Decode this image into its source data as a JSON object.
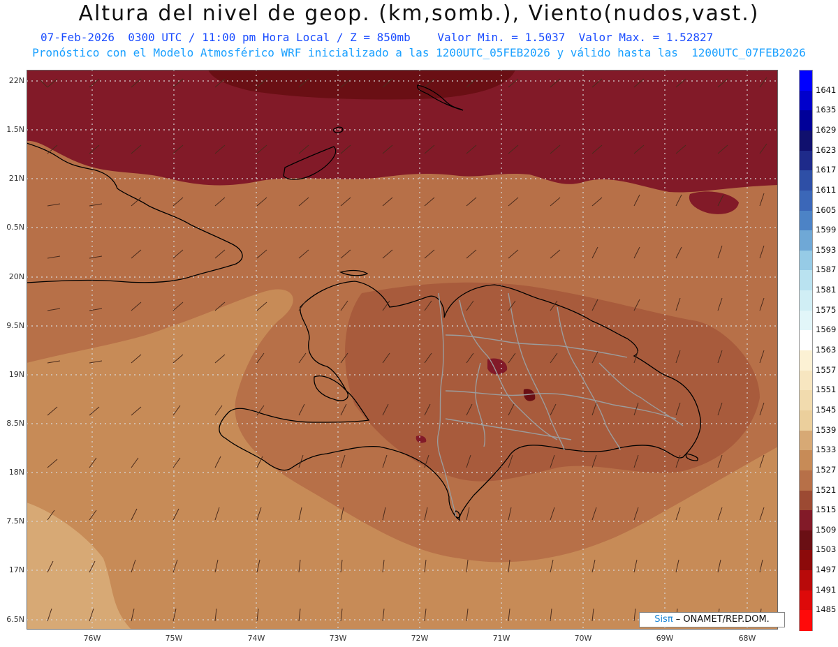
{
  "title": "Altura del nivel de geop. (km,somb.), Viento(nudos,vast.)",
  "subtitle_line1": "07-Feb-2026  0300 UTC / 11:00 pm Hora Local / Z = 850mb    Valor Min. = 1.5037  Valor Max. = 1.52827",
  "subtitle_line2": "Pronóstico con el Modelo Atmosférico WRF inicializado a las 1200UTC_05FEB2026 y válido hasta las  1200UTC_07FEB2026",
  "lat_labels": [
    "22N",
    "1.5N",
    "21N",
    "0.5N",
    "20N",
    "9.5N",
    "19N",
    "8.5N",
    "18N",
    "7.5N",
    "17N",
    "6.5N"
  ],
  "lon_labels": [
    "76W",
    "75W",
    "74W",
    "73W",
    "72W",
    "71W",
    "70W",
    "69W",
    "68W"
  ],
  "colorbar": {
    "labels": [
      "1641",
      "1635",
      "1629",
      "1623",
      "1617",
      "1611",
      "1605",
      "1599",
      "1593",
      "1587",
      "1581",
      "1575",
      "1569",
      "1563",
      "1557",
      "1551",
      "1545",
      "1539",
      "1533",
      "1527",
      "1521",
      "1515",
      "1509",
      "1503",
      "1497",
      "1491",
      "1485"
    ],
    "colors": [
      "#0000ff",
      "#0000cc",
      "#000099",
      "#10106e",
      "#1e2a8a",
      "#2e4fa6",
      "#3b67b8",
      "#4c83c6",
      "#6fa8d6",
      "#96cbe6",
      "#b9e2f0",
      "#d0eef5",
      "#e2f6f9",
      "#ffffff",
      "#fcf1d4",
      "#f7e6c0",
      "#f1dbae",
      "#ebcf9c",
      "#d7a975",
      "#c78b57",
      "#b77048",
      "#9c4a33",
      "#821a28",
      "#6a0f14",
      "#8c0a0a",
      "#b80a0a",
      "#dd0a0a",
      "#ff0a0a"
    ]
  },
  "credit": {
    "brand": "Sisπ",
    "text": " – ONAMET/REP.DOM."
  }
}
